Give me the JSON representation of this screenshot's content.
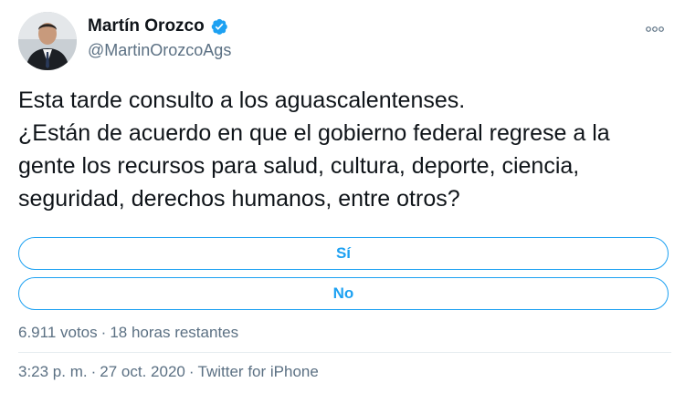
{
  "author": {
    "name": "Martín Orozco",
    "handle": "@MartinOrozcoAgs"
  },
  "icons": {
    "verified": "verified-badge-icon",
    "more": "more-options-icon"
  },
  "colors": {
    "accent": "#1da1f2",
    "secondary_text": "#5b7083",
    "primary_text": "#0f1419"
  },
  "tweet": {
    "text": "Esta tarde consulto a los aguascalentenses.\n¿Están de acuerdo en que el gobierno federal regrese a la gente los recursos para salud, cultura, deporte, ciencia, seguridad, derechos humanos, entre otros?"
  },
  "poll": {
    "options": [
      "Sí",
      "No"
    ],
    "votes": "6.911 votos",
    "time_left": "18 horas restantes",
    "separator": "·"
  },
  "footer": {
    "time": "3:23 p. m.",
    "date": "27 oct. 2020",
    "source": "Twitter for iPhone",
    "separator": "·"
  }
}
